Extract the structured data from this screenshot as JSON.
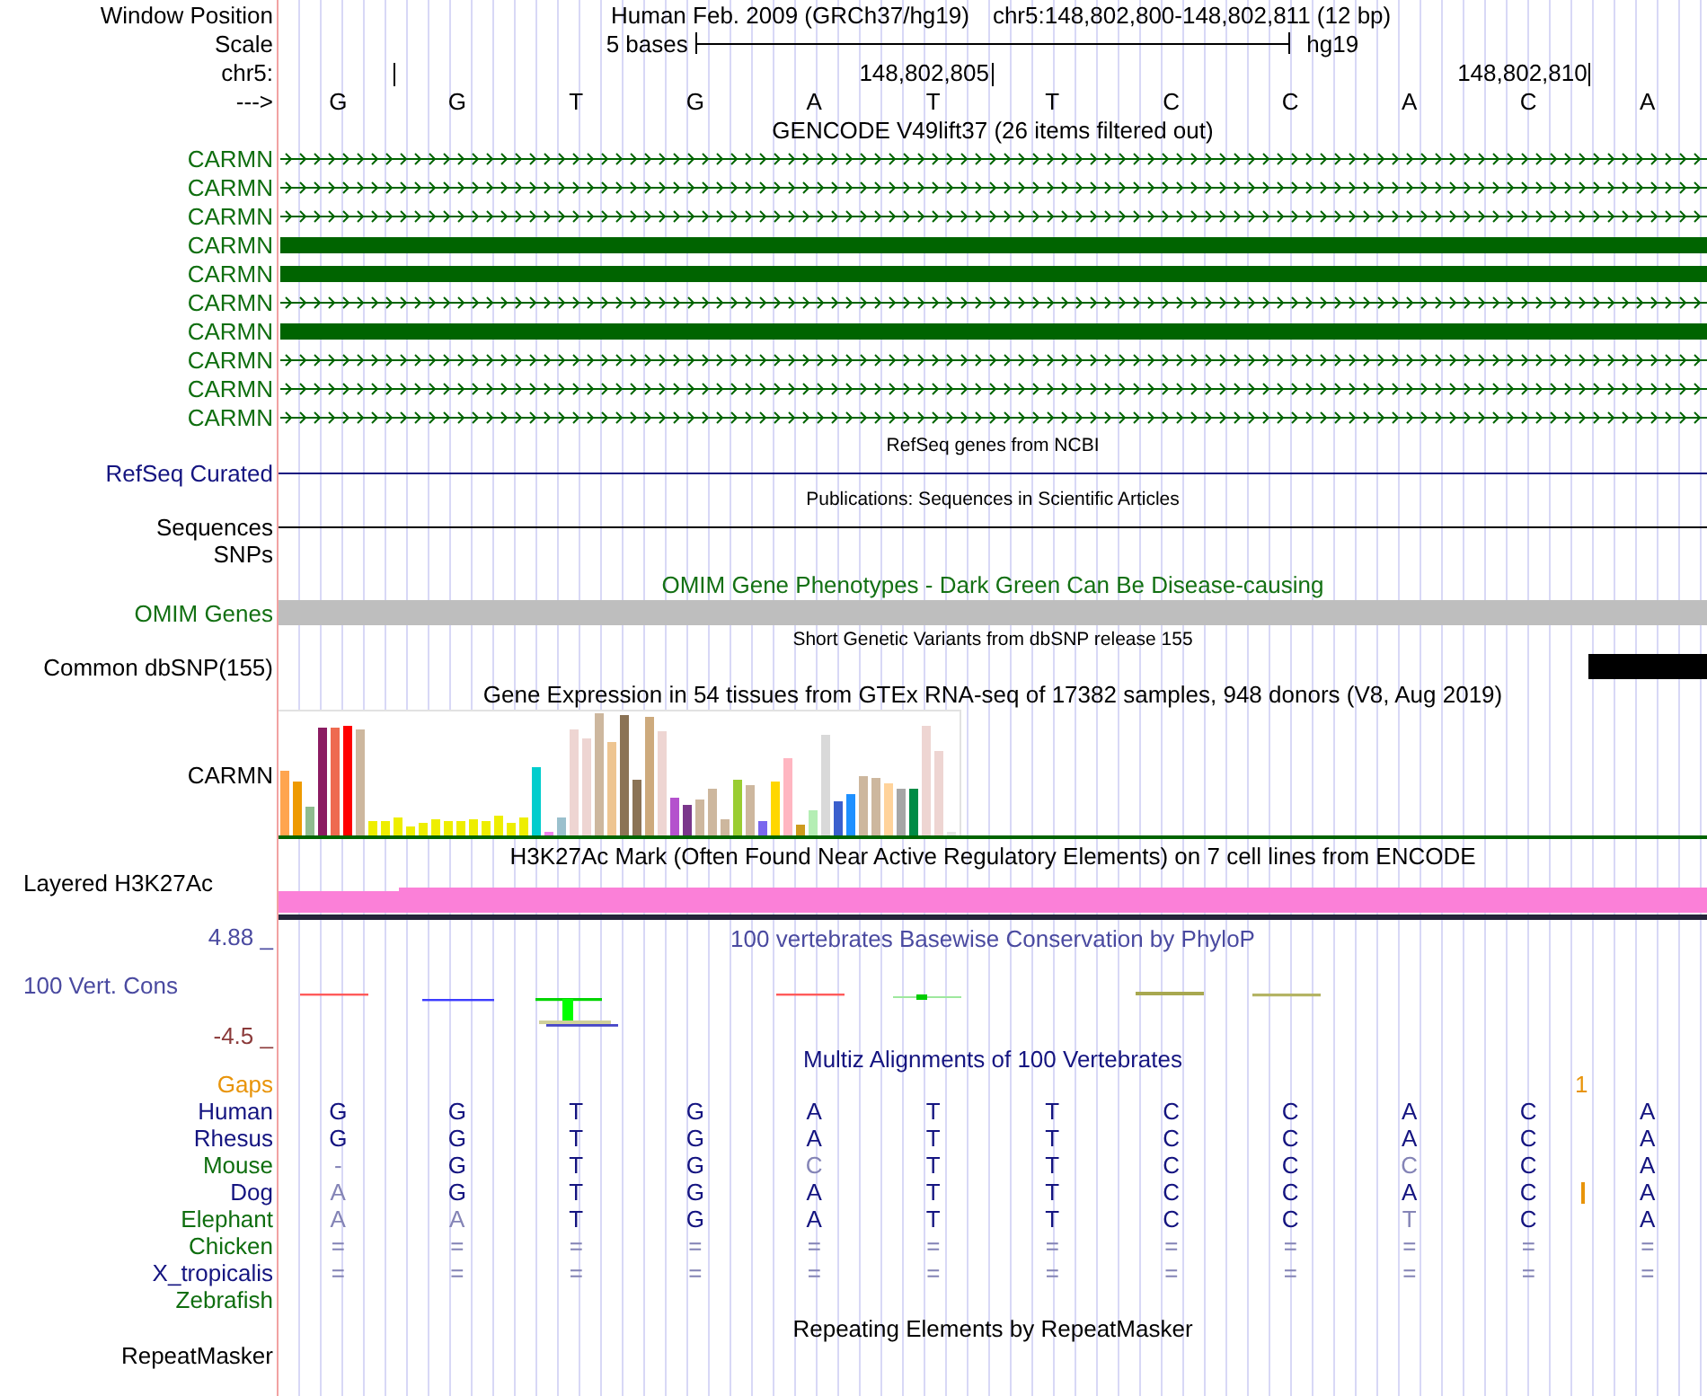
{
  "header": {
    "position_label": "Window Position",
    "assembly": "Human Feb. 2009 (GRCh37/hg19)",
    "position": "chr5:148,802,800-148,802,811 (12 bp)",
    "scale_label": "Scale",
    "scale_span": "5 bases",
    "scale_assembly": "hg19",
    "chrom_label": "chr5:",
    "strand_label": "--->"
  },
  "bases": [
    {
      "letter": "G",
      "tick": true
    },
    {
      "letter": "G",
      "tick": false
    },
    {
      "letter": "T",
      "tick": false
    },
    {
      "letter": "G",
      "tick": false
    },
    {
      "letter": "A",
      "tick": false
    },
    {
      "letter": "T",
      "tick": true,
      "tick_label": "148,802,805"
    },
    {
      "letter": "T",
      "tick": false
    },
    {
      "letter": "C",
      "tick": false
    },
    {
      "letter": "C",
      "tick": false
    },
    {
      "letter": "A",
      "tick": false
    },
    {
      "letter": "C",
      "tick": true,
      "tick_label": "148,802,810"
    },
    {
      "letter": "A",
      "tick": false
    }
  ],
  "tracks": [
    {
      "kind": "gencode",
      "title": "GENCODE V49lift37 (26 items filtered out)",
      "rows": [
        {
          "label": "CARMN",
          "kind": "arrows"
        },
        {
          "label": "CARMN",
          "kind": "arrows"
        },
        {
          "label": "CARMN",
          "kind": "arrows"
        },
        {
          "label": "CARMN",
          "kind": "block"
        },
        {
          "label": "CARMN",
          "kind": "block"
        },
        {
          "label": "CARMN",
          "kind": "arrows"
        },
        {
          "label": "CARMN",
          "kind": "block"
        },
        {
          "label": "CARMN",
          "kind": "arrows"
        },
        {
          "label": "CARMN",
          "kind": "arrows"
        },
        {
          "label": "CARMN",
          "kind": "arrows"
        }
      ]
    },
    {
      "kind": "refseq",
      "title": "RefSeq genes from NCBI",
      "label": "RefSeq Curated"
    },
    {
      "kind": "publications",
      "title": "Publications: Sequences in Scientific Articles",
      "label": "Sequences"
    },
    {
      "kind": "snps",
      "label": "SNPs"
    },
    {
      "kind": "omim",
      "title": "OMIM Gene Phenotypes - Dark Green Can Be Disease-causing",
      "label": "OMIM Genes"
    },
    {
      "kind": "dbsnp",
      "title": "Short Genetic Variants from dbSNP release 155",
      "label": "Common dbSNP(155)",
      "hits": [
        false,
        false,
        false,
        false,
        false,
        false,
        false,
        false,
        false,
        false,
        false,
        true
      ]
    },
    {
      "kind": "gtex",
      "title": "Gene Expression in 54 tissues from GTEx RNA-seq of 17382 samples, 948 donors (V8, Aug 2019)",
      "label": "CARMN"
    },
    {
      "kind": "h3k27ac",
      "title": "H3K27Ac Mark (Often Found Near Active Regulatory Elements) on 7 cell lines from ENCODE",
      "label": "Layered H3K27Ac"
    },
    {
      "kind": "phylop",
      "title": "100 vertebrates Basewise Conservation by PhyloP",
      "label": "100 Vert. Cons",
      "max_label": "4.88 _",
      "min_label": "-4.5 _"
    },
    {
      "kind": "multiz",
      "title": "Multiz Alignments of 100 Vertebrates",
      "gaps": {
        "label": "Gaps",
        "count": "1"
      },
      "species": [
        {
          "name": "Human",
          "color": "#141480",
          "bases": [
            {
              "base": "G",
              "match": true,
              "insert": false
            },
            {
              "base": "G",
              "match": true,
              "insert": false
            },
            {
              "base": "T",
              "match": true,
              "insert": false
            },
            {
              "base": "G",
              "match": true,
              "insert": false
            },
            {
              "base": "A",
              "match": true,
              "insert": false
            },
            {
              "base": "T",
              "match": true,
              "insert": false
            },
            {
              "base": "T",
              "match": true,
              "insert": false
            },
            {
              "base": "C",
              "match": true,
              "insert": false
            },
            {
              "base": "C",
              "match": true,
              "insert": false
            },
            {
              "base": "A",
              "match": true,
              "insert": false
            },
            {
              "base": "C",
              "match": true,
              "insert": false
            },
            {
              "base": "A",
              "match": true,
              "insert": false
            }
          ]
        },
        {
          "name": "Rhesus",
          "color": "#141480",
          "bases": [
            {
              "base": "G",
              "match": true,
              "insert": false
            },
            {
              "base": "G",
              "match": true,
              "insert": false
            },
            {
              "base": "T",
              "match": true,
              "insert": false
            },
            {
              "base": "G",
              "match": true,
              "insert": false
            },
            {
              "base": "A",
              "match": true,
              "insert": false
            },
            {
              "base": "T",
              "match": true,
              "insert": false
            },
            {
              "base": "T",
              "match": true,
              "insert": false
            },
            {
              "base": "C",
              "match": true,
              "insert": false
            },
            {
              "base": "C",
              "match": true,
              "insert": false
            },
            {
              "base": "A",
              "match": true,
              "insert": false
            },
            {
              "base": "C",
              "match": true,
              "insert": false
            },
            {
              "base": "A",
              "match": true,
              "insert": false
            }
          ]
        },
        {
          "name": "Mouse",
          "color": "#0f6e0f",
          "bases": [
            {
              "base": "-",
              "match": false,
              "insert": false
            },
            {
              "base": "G",
              "match": true,
              "insert": false
            },
            {
              "base": "T",
              "match": true,
              "insert": false
            },
            {
              "base": "G",
              "match": true,
              "insert": false
            },
            {
              "base": "C",
              "match": false,
              "insert": false
            },
            {
              "base": "T",
              "match": true,
              "insert": false
            },
            {
              "base": "T",
              "match": true,
              "insert": false
            },
            {
              "base": "C",
              "match": true,
              "insert": false
            },
            {
              "base": "C",
              "match": true,
              "insert": false
            },
            {
              "base": "C",
              "match": false,
              "insert": false
            },
            {
              "base": "C",
              "match": true,
              "insert": false
            },
            {
              "base": "A",
              "match": true,
              "insert": false
            }
          ]
        },
        {
          "name": "Dog",
          "color": "#141480",
          "bases": [
            {
              "base": "A",
              "match": false,
              "insert": false
            },
            {
              "base": "G",
              "match": true,
              "insert": false
            },
            {
              "base": "T",
              "match": true,
              "insert": false
            },
            {
              "base": "G",
              "match": true,
              "insert": false
            },
            {
              "base": "A",
              "match": true,
              "insert": false
            },
            {
              "base": "T",
              "match": true,
              "insert": false
            },
            {
              "base": "T",
              "match": true,
              "insert": false
            },
            {
              "base": "C",
              "match": true,
              "insert": false
            },
            {
              "base": "C",
              "match": true,
              "insert": false
            },
            {
              "base": "A",
              "match": true,
              "insert": false
            },
            {
              "base": "C",
              "match": true,
              "insert": true
            },
            {
              "base": "A",
              "match": true,
              "insert": false
            }
          ]
        },
        {
          "name": "Elephant",
          "color": "#0f6e0f",
          "bases": [
            {
              "base": "A",
              "match": false,
              "insert": false
            },
            {
              "base": "A",
              "match": false,
              "insert": false
            },
            {
              "base": "T",
              "match": true,
              "insert": false
            },
            {
              "base": "G",
              "match": true,
              "insert": false
            },
            {
              "base": "A",
              "match": true,
              "insert": false
            },
            {
              "base": "T",
              "match": true,
              "insert": false
            },
            {
              "base": "T",
              "match": true,
              "insert": false
            },
            {
              "base": "C",
              "match": true,
              "insert": false
            },
            {
              "base": "C",
              "match": true,
              "insert": false
            },
            {
              "base": "T",
              "match": false,
              "insert": false
            },
            {
              "base": "C",
              "match": true,
              "insert": false
            },
            {
              "base": "A",
              "match": true,
              "insert": false
            }
          ]
        },
        {
          "name": "Chicken",
          "color": "#0f6e0f",
          "bases": [
            {
              "base": "=",
              "match": false,
              "insert": false
            },
            {
              "base": "=",
              "match": false,
              "insert": false
            },
            {
              "base": "=",
              "match": false,
              "insert": false
            },
            {
              "base": "=",
              "match": false,
              "insert": false
            },
            {
              "base": "=",
              "match": false,
              "insert": false
            },
            {
              "base": "=",
              "match": false,
              "insert": false
            },
            {
              "base": "=",
              "match": false,
              "insert": false
            },
            {
              "base": "=",
              "match": false,
              "insert": false
            },
            {
              "base": "=",
              "match": false,
              "insert": false
            },
            {
              "base": "=",
              "match": false,
              "insert": false
            },
            {
              "base": "=",
              "match": false,
              "insert": false
            },
            {
              "base": "=",
              "match": false,
              "insert": false
            }
          ]
        },
        {
          "name": "X_tropicalis",
          "color": "#141480",
          "bases": [
            {
              "base": "=",
              "match": false,
              "insert": false
            },
            {
              "base": "=",
              "match": false,
              "insert": false
            },
            {
              "base": "=",
              "match": false,
              "insert": false
            },
            {
              "base": "=",
              "match": false,
              "insert": false
            },
            {
              "base": "=",
              "match": false,
              "insert": false
            },
            {
              "base": "=",
              "match": false,
              "insert": false
            },
            {
              "base": "=",
              "match": false,
              "insert": false
            },
            {
              "base": "=",
              "match": false,
              "insert": false
            },
            {
              "base": "=",
              "match": false,
              "insert": false
            },
            {
              "base": "=",
              "match": false,
              "insert": false
            },
            {
              "base": "=",
              "match": false,
              "insert": false
            },
            {
              "base": "=",
              "match": false,
              "insert": false
            }
          ]
        },
        {
          "name": "Zebrafish",
          "color": "#0f6e0f"
        }
      ]
    },
    {
      "kind": "repeatmasker",
      "title": "Repeating Elements by RepeatMasker",
      "label": "RepeatMasker"
    }
  ]
}
